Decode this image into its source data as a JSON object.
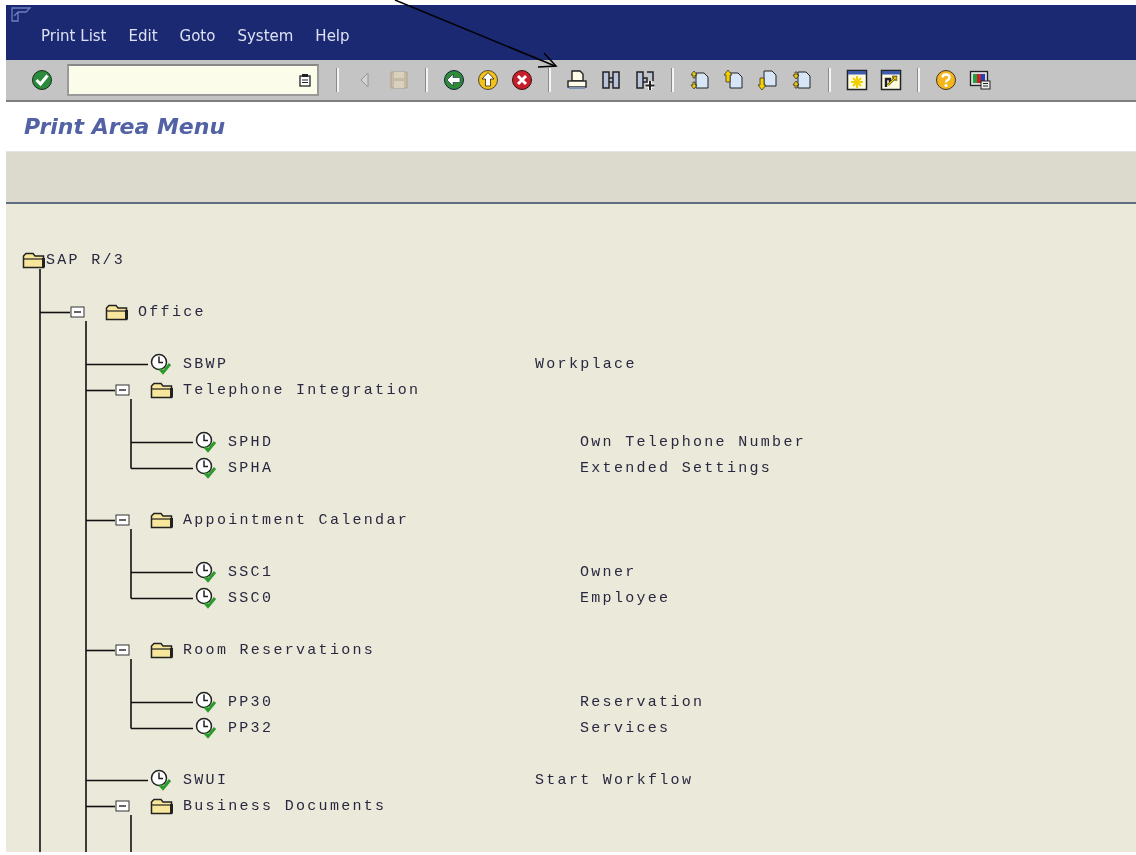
{
  "window": {
    "menu": [
      {
        "label": "Print List"
      },
      {
        "label": "Edit"
      },
      {
        "label": "Goto"
      },
      {
        "label": "System"
      },
      {
        "label": "Help"
      }
    ]
  },
  "toolbar": [
    {
      "kind": "enter",
      "disabled": false
    },
    {
      "kind": "command_field"
    },
    {
      "kind": "separator"
    },
    {
      "kind": "prev_field",
      "disabled": true
    },
    {
      "kind": "save",
      "disabled": true
    },
    {
      "kind": "separator"
    },
    {
      "kind": "back",
      "disabled": false
    },
    {
      "kind": "exit",
      "disabled": false
    },
    {
      "kind": "cancel",
      "disabled": false
    },
    {
      "kind": "separator"
    },
    {
      "kind": "print",
      "disabled": false
    },
    {
      "kind": "find",
      "disabled": false
    },
    {
      "kind": "find_next",
      "disabled": false
    },
    {
      "kind": "separator"
    },
    {
      "kind": "first_page",
      "disabled": false
    },
    {
      "kind": "prev_page",
      "disabled": false
    },
    {
      "kind": "next_page",
      "disabled": false
    },
    {
      "kind": "last_page",
      "disabled": false
    },
    {
      "kind": "separator"
    },
    {
      "kind": "new_session",
      "disabled": false
    },
    {
      "kind": "shortcut",
      "disabled": false
    },
    {
      "kind": "separator"
    },
    {
      "kind": "help",
      "disabled": false
    },
    {
      "kind": "layout",
      "disabled": false
    }
  ],
  "screen_title": "Print Area Menu",
  "tree": {
    "kind": "root",
    "label": "SAP R/3",
    "children": [
      {
        "kind": "folder",
        "label": "Office",
        "expanded": true,
        "children": [
          {
            "kind": "transaction",
            "label": "SBWP",
            "description": "Workplace"
          },
          {
            "kind": "folder",
            "label": "Telephone Integration",
            "expanded": true,
            "children": [
              {
                "kind": "transaction",
                "label": "SPHD",
                "description": "Own Telephone Number"
              },
              {
                "kind": "transaction",
                "label": "SPHA",
                "description": "Extended Settings"
              }
            ]
          },
          {
            "kind": "folder",
            "label": "Appointment Calendar",
            "expanded": true,
            "children": [
              {
                "kind": "transaction",
                "label": "SSC1",
                "description": "Owner"
              },
              {
                "kind": "transaction",
                "label": "SSC0",
                "description": "Employee"
              }
            ]
          },
          {
            "kind": "folder",
            "label": "Room Reservations",
            "expanded": true,
            "children": [
              {
                "kind": "transaction",
                "label": "PP30",
                "description": "Reservation"
              },
              {
                "kind": "transaction",
                "label": "PP32",
                "description": "Services"
              }
            ]
          },
          {
            "kind": "transaction",
            "label": "SWUI",
            "description": "Start Workflow"
          },
          {
            "kind": "folder",
            "label": "Business Documents",
            "expanded": true
          }
        ]
      }
    ]
  }
}
